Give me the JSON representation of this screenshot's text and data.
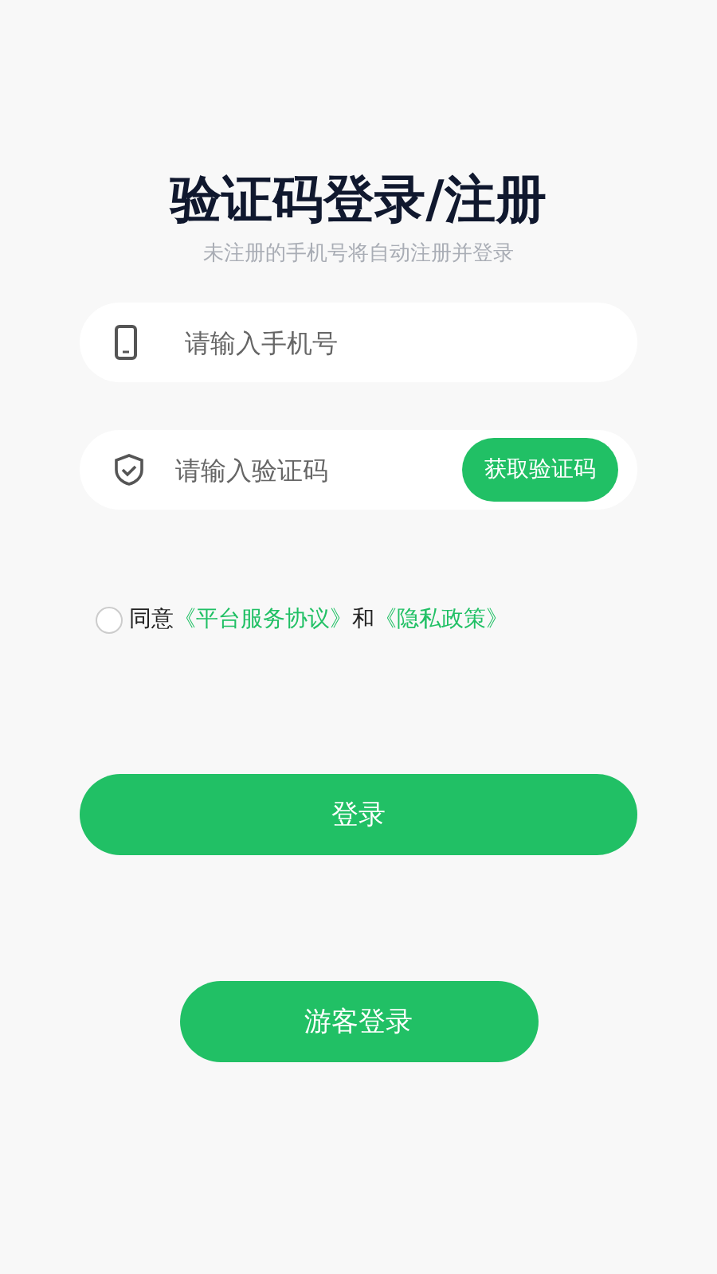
{
  "title": "验证码登录/注册",
  "subtitle": "未注册的手机号将自动注册并登录",
  "phone_field": {
    "placeholder": "请输入手机号"
  },
  "code_field": {
    "placeholder": "请输入验证码",
    "button": "获取验证码"
  },
  "agreement": {
    "checked": false,
    "prefix": "同意",
    "link_1": "《平台服务协议》",
    "middle": "和",
    "link_2": "《隐私政策》"
  },
  "login_button": "登录",
  "guest_button": "游客登录"
}
